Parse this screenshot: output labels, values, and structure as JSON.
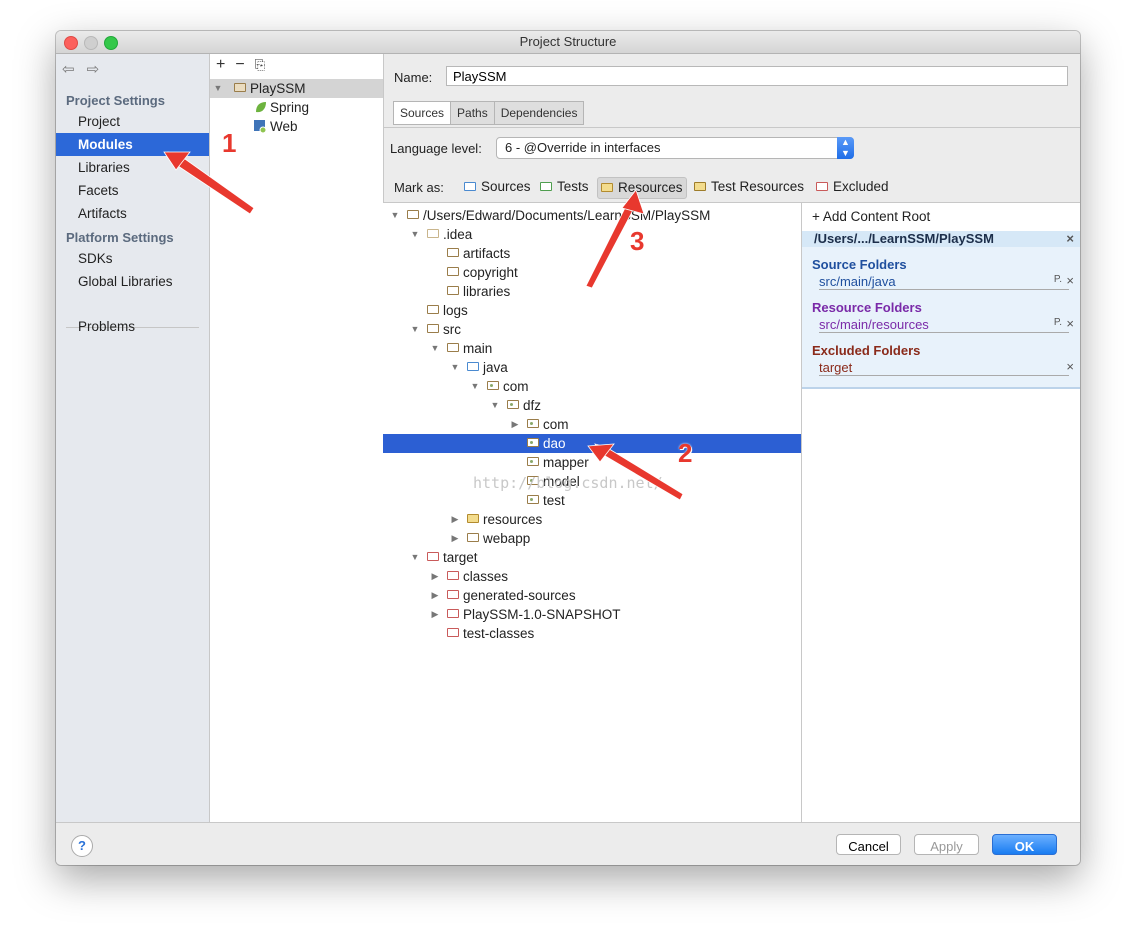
{
  "window": {
    "title": "Project Structure"
  },
  "nav": {
    "back_icon": "back-arrow-icon",
    "forward_icon": "forward-arrow-icon",
    "project_settings": "Project Settings",
    "items_top": [
      "Project",
      "Modules",
      "Libraries",
      "Facets",
      "Artifacts"
    ],
    "platform_settings": "Platform Settings",
    "items_platform": [
      "SDKs",
      "Global Libraries"
    ],
    "problems": "Problems",
    "selected": "Modules",
    "selected_color": "#2c68d8"
  },
  "modules": {
    "tools": {
      "add": "+",
      "remove": "−",
      "copy_icon": "copy-icon"
    },
    "items": [
      {
        "label": "PlaySSM",
        "icon": "module-folder-icon"
      },
      {
        "label": "Spring",
        "icon": "spring-leaf-icon"
      },
      {
        "label": "Web",
        "icon": "web-icon"
      }
    ]
  },
  "details": {
    "name_label": "Name:",
    "name_value": "PlaySSM",
    "tabs": [
      "Sources",
      "Paths",
      "Dependencies"
    ],
    "active_tab": "Sources",
    "language_label": "Language level:",
    "language_value": "6 - @Override in interfaces",
    "mark_as_label": "Mark as:",
    "mark_buttons": [
      "Sources",
      "Tests",
      "Resources",
      "Test Resources",
      "Excluded"
    ]
  },
  "tree": {
    "root": "/Users/Edward/Documents/LearnSSM/PlaySSM",
    "rows": [
      {
        "label": "/Users/Edward/Documents/LearnSSM/PlaySSM",
        "toggle": "▼"
      },
      {
        "label": ".idea",
        "toggle": "▼"
      },
      {
        "label": "artifacts",
        "toggle": ""
      },
      {
        "label": "copyright",
        "toggle": ""
      },
      {
        "label": "libraries",
        "toggle": ""
      },
      {
        "label": "logs",
        "toggle": ""
      },
      {
        "label": "src",
        "toggle": "▼"
      },
      {
        "label": "main",
        "toggle": "▼"
      },
      {
        "label": "java",
        "toggle": "▼"
      },
      {
        "label": "com",
        "toggle": "▼"
      },
      {
        "label": "dfz",
        "toggle": "▼"
      },
      {
        "label": "com",
        "toggle": "▶"
      },
      {
        "label": "dao",
        "toggle": ""
      },
      {
        "label": "mapper",
        "toggle": ""
      },
      {
        "label": "model",
        "toggle": ""
      },
      {
        "label": "test",
        "toggle": ""
      },
      {
        "label": "resources",
        "toggle": "▶"
      },
      {
        "label": "webapp",
        "toggle": "▶"
      },
      {
        "label": "target",
        "toggle": "▼"
      },
      {
        "label": "classes",
        "toggle": "▶"
      },
      {
        "label": "generated-sources",
        "toggle": "▶"
      },
      {
        "label": "PlaySSM-1.0-SNAPSHOT",
        "toggle": "▶"
      },
      {
        "label": "test-classes",
        "toggle": ""
      }
    ],
    "selected": "dao",
    "selected_color": "#2c5fd3"
  },
  "roots": {
    "add_label": "+ Add Content Root",
    "root_path": "/Users/.../LearnSSM/PlaySSM",
    "source_header": "Source Folders",
    "source_path": "src/main/java",
    "resource_header": "Resource Folders",
    "resource_path": "src/main/resources",
    "excluded_header": "Excluded Folders",
    "excluded_path": "target",
    "package_prefix_icon": "P.",
    "remove_icon": "×",
    "colors": {
      "source": "#1f4f9e",
      "resource": "#7a2aa8",
      "excluded": "#8a2a1a"
    }
  },
  "footer": {
    "help": "?",
    "cancel": "Cancel",
    "apply": "Apply",
    "ok": "OK"
  },
  "overlay": {
    "watermark": "http://blog.csdn.net/",
    "annotations": [
      "1",
      "2",
      "3"
    ],
    "annotation_color": "#e8382e"
  }
}
